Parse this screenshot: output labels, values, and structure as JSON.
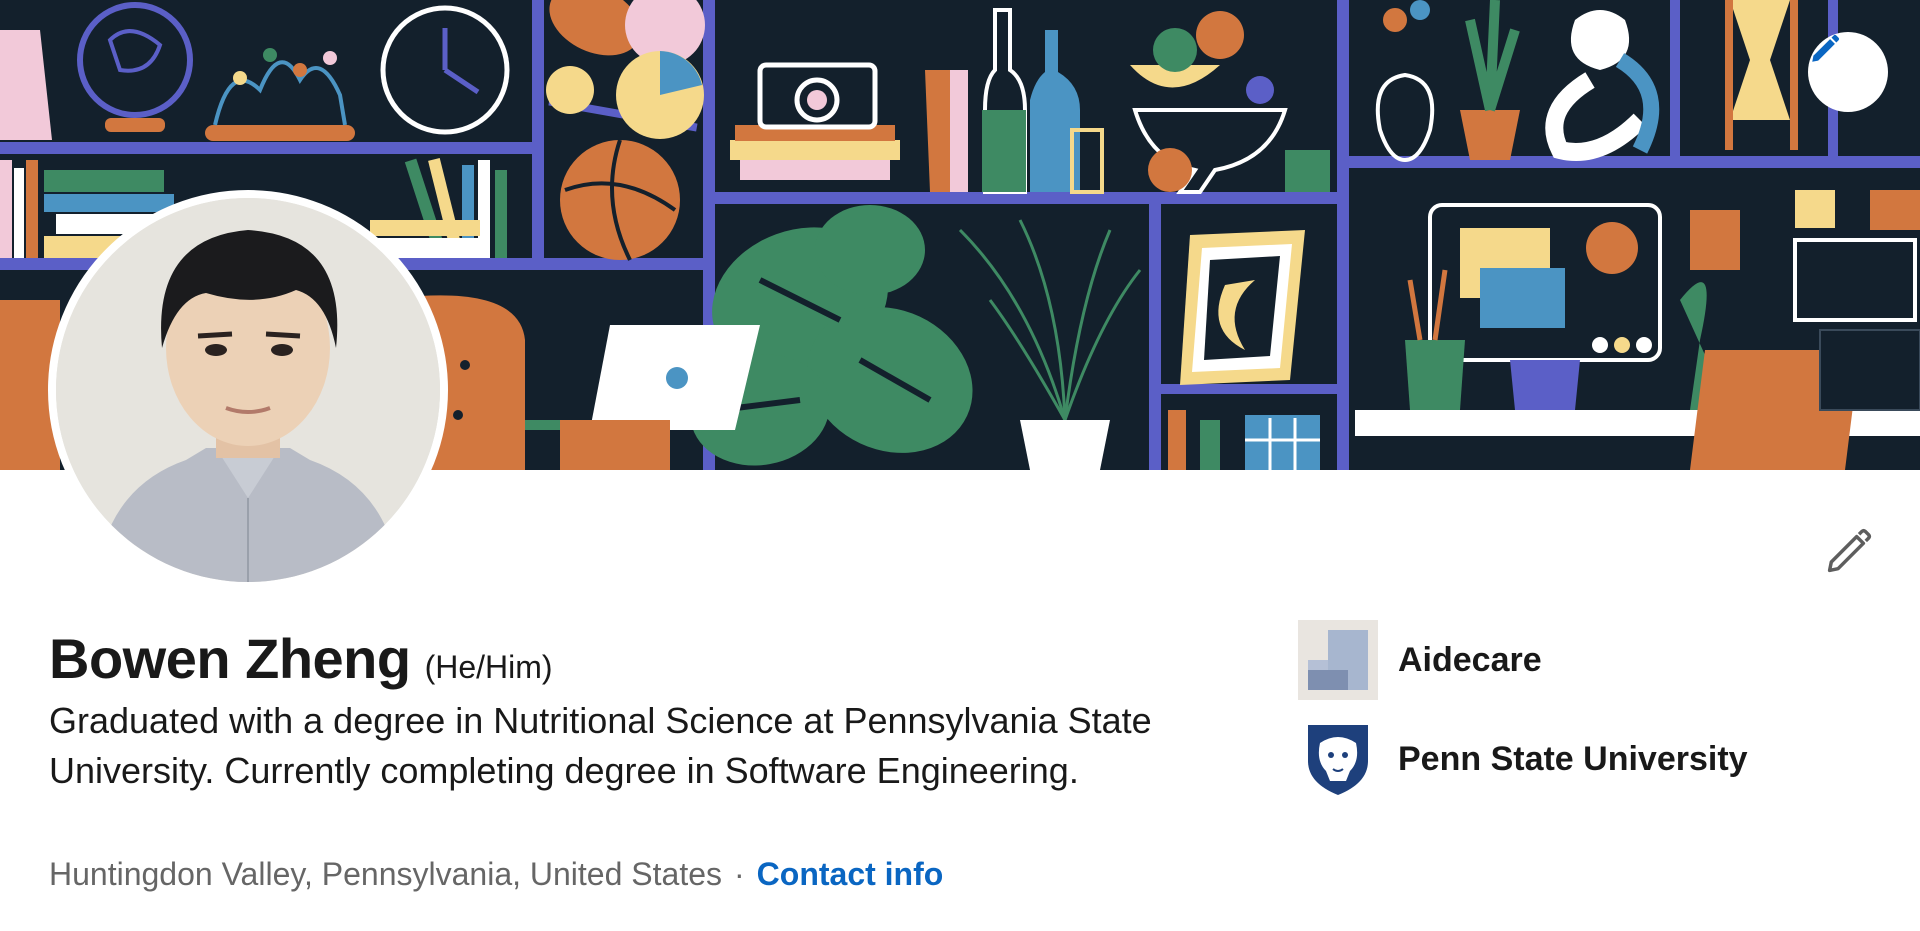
{
  "profile": {
    "name": "Bowen Zheng",
    "pronouns": "(He/Him)",
    "headline": "Graduated with a degree in Nutritional Science at Pennsylvania State University. Currently completing degree in Software Engineering.",
    "location": "Huntingdon Valley, Pennsylvania, United States",
    "separator": "·",
    "contact_label": "Contact info"
  },
  "organizations": [
    {
      "name": "Aidecare",
      "logo_icon": "aidecare-logo-icon"
    },
    {
      "name": "Penn State University",
      "logo_icon": "penn-state-shield-icon"
    }
  ],
  "icons": {
    "banner_edit": "pencil-icon",
    "intro_edit": "pencil-icon"
  },
  "colors": {
    "link": "#0a66c2",
    "text": "#191919",
    "muted": "#666666",
    "banner_bg": "#13202c",
    "shelf": "#5b5fc7",
    "accent_orange": "#d2773f",
    "accent_green": "#3e8a63",
    "accent_yellow": "#f5d98b",
    "accent_blue": "#4b94c3"
  }
}
